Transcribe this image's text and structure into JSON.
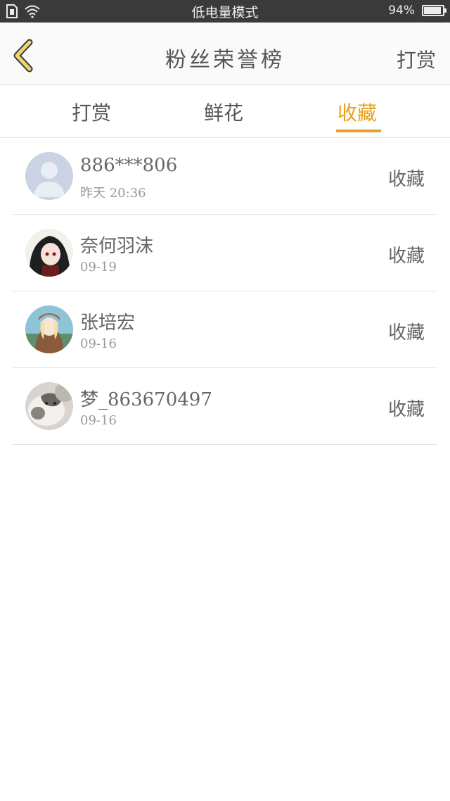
{
  "status_bar": {
    "mode": "低电量模式",
    "battery_percent": "94%",
    "battery_level": 0.94,
    "icons": [
      "sim-card-icon",
      "wifi-icon",
      "battery-icon"
    ]
  },
  "header": {
    "title": "粉丝荣誉榜",
    "action": "打赏",
    "back_icon": "chevron-left-icon",
    "accent": "#e8a01e"
  },
  "tabs": [
    {
      "label": "打赏",
      "active": false
    },
    {
      "label": "鲜花",
      "active": false
    },
    {
      "label": "收藏",
      "active": true
    }
  ],
  "fans": [
    {
      "name": "886***806",
      "time": "昨天 20:36",
      "action": "收藏",
      "avatar": "default-avatar-icon"
    },
    {
      "name": "奈何羽沫",
      "time": "09-19",
      "action": "收藏",
      "avatar": "anime-avatar"
    },
    {
      "name": "张培宏",
      "time": "09-16",
      "action": "收藏",
      "avatar": "anime-avatar"
    },
    {
      "name": "梦_863670497",
      "time": "09-16",
      "action": "收藏",
      "avatar": "cat-avatar"
    }
  ]
}
